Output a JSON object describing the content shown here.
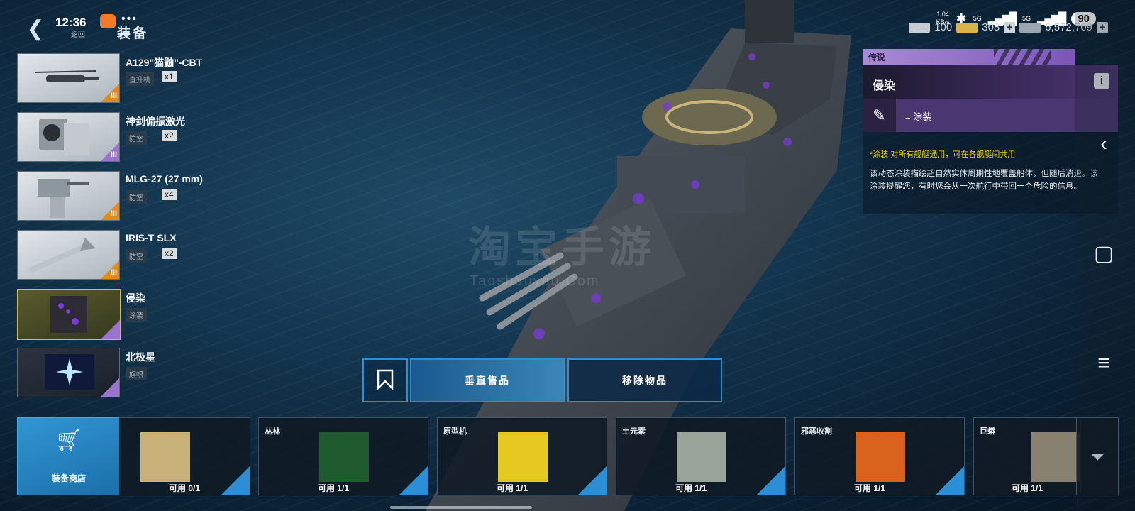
{
  "status": {
    "time": "12:36",
    "dots": "•••",
    "net_speed": "1.04\nKB/s",
    "net_type": "5G",
    "battery": "90"
  },
  "header": {
    "back_label": "返回",
    "title": "装备"
  },
  "currency": [
    {
      "value": "100",
      "color": "#c6ccd2"
    },
    {
      "value": "308",
      "color": "#d8b24a"
    },
    {
      "value": "6,572,709",
      "color": "#9aa5ad"
    }
  ],
  "equipment": [
    {
      "name": "A129\"猫鼬\"-CBT",
      "tag": "直升机",
      "qty": "x1",
      "tier": "III",
      "locked": false,
      "tier_color": "#e28b1b"
    },
    {
      "name": "神剑偏振激光",
      "tag": "防空",
      "qty": "x2",
      "tier": "III",
      "locked": false,
      "tier_color": "#9b72cc"
    },
    {
      "name": "MLG-27 (27 mm)",
      "tag": "防空",
      "qty": "x4",
      "tier": "III",
      "locked": true,
      "tier_color": "#e28b1b"
    },
    {
      "name": "IRIS-T SLX",
      "tag": "防空",
      "qty": "x2",
      "tier": "III",
      "locked": true,
      "tier_color": "#e28b1b"
    },
    {
      "name": "侵染",
      "tag": "涂装",
      "qty": "",
      "tier": "",
      "locked": false,
      "tier_color": "#9b72cc"
    },
    {
      "name": "北极星",
      "tag": "旗帜",
      "qty": "",
      "tier": "",
      "locked": false,
      "tier_color": "#9b72cc"
    }
  ],
  "detail": {
    "rank": "传说",
    "title": "侵染",
    "info_icon": "i",
    "type_label": "= 涂装",
    "note": "*涂装 对所有舰艇通用，可在各舰艇间共用",
    "description": "该动态涂装描绘超自然实体周期性地覆盖船体，但随后消退。该涂装提醒您，有时您会从一次航行中带回一个危险的信息。"
  },
  "actions": {
    "equip": "垂直售品",
    "remove": "移除物品"
  },
  "shop": {
    "label": "装备商店"
  },
  "categories": [
    {
      "title": "",
      "avail": "可用 0/1",
      "thumb_color": "#c9b27a"
    },
    {
      "title": "丛林",
      "avail": "可用 1/1",
      "thumb_color": "#1f5a2e"
    },
    {
      "title": "原型机",
      "avail": "可用 1/1",
      "thumb_color": "#e6c920"
    },
    {
      "title": "土元素",
      "avail": "可用 1/1",
      "thumb_color": "#9aa39a"
    },
    {
      "title": "邪恶收割",
      "avail": "可用 1/1",
      "thumb_color": "#d9621c"
    },
    {
      "title": "巨蟒",
      "avail": "可用 1/1",
      "thumb_color": "#8a8270"
    }
  ],
  "watermark": {
    "main": "淘宝手游",
    "sub": "Taoshouyou.Com"
  },
  "icons": {
    "back": "chevron-left-icon",
    "cart": "cart-icon",
    "filter": "filter-icon",
    "bookmark": "bookmark-icon"
  }
}
